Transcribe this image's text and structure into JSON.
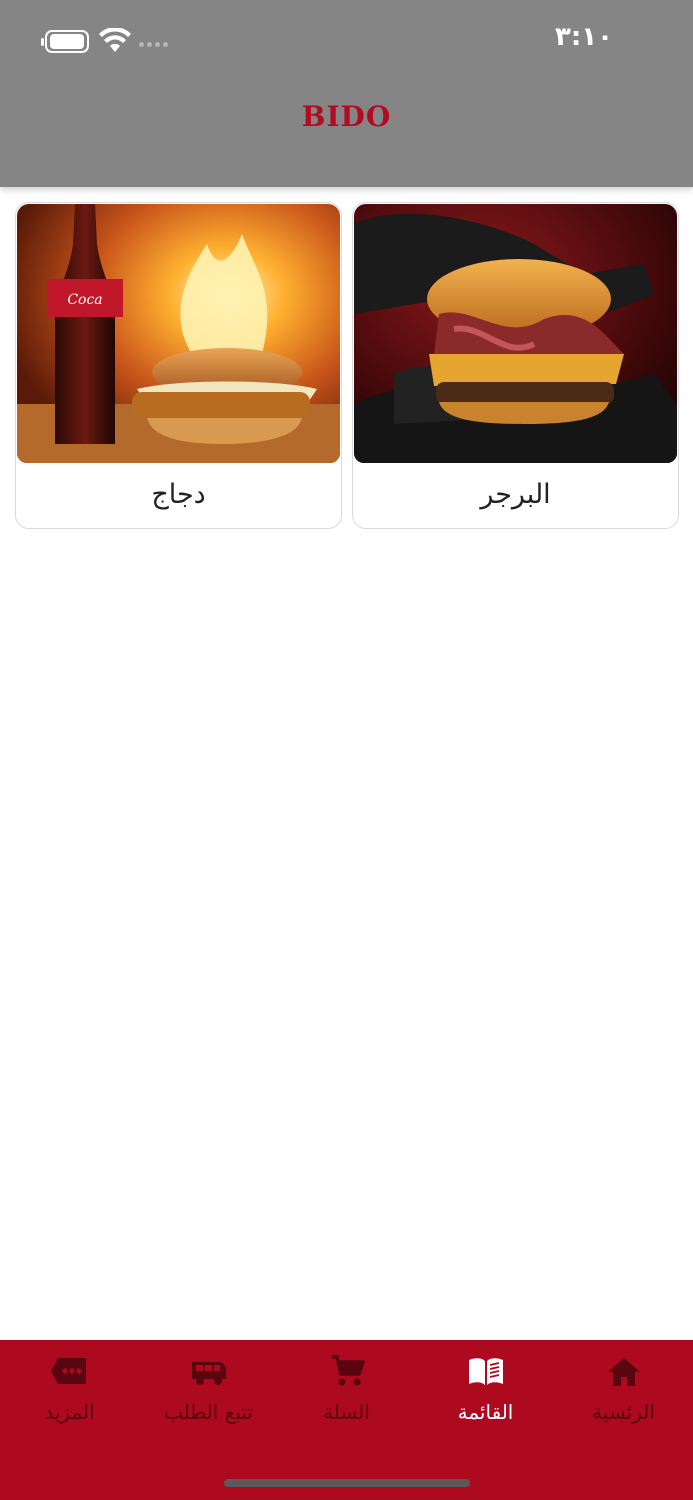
{
  "status_bar": {
    "time": "٣:١٠"
  },
  "header": {
    "brand": "BIDO"
  },
  "categories": [
    {
      "label": "البرجر",
      "image": "burger-photo"
    },
    {
      "label": "دجاج",
      "image": "chicken-burger-cola-photo"
    }
  ],
  "bottom_nav": {
    "items": [
      {
        "label": "الرئسية",
        "icon": "home-icon",
        "active": false
      },
      {
        "label": "القائمة",
        "icon": "menu-book-icon",
        "active": true
      },
      {
        "label": "السلة",
        "icon": "cart-icon",
        "active": false
      },
      {
        "label": "تتبع الطلب",
        "icon": "delivery-van-icon",
        "active": false
      },
      {
        "label": "المزيد",
        "icon": "more-icon",
        "active": false
      }
    ]
  },
  "colors": {
    "brand_red": "#ad0a20",
    "header_gray": "#858585",
    "active_white": "#ffffff",
    "inactive": "#5a0610"
  }
}
